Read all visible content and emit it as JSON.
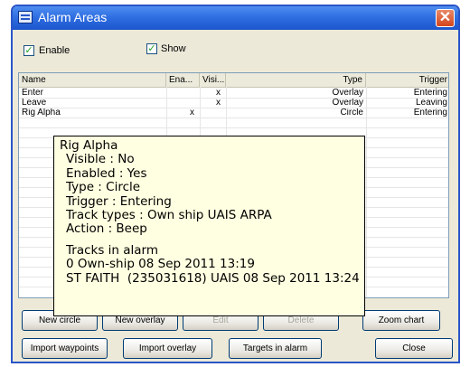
{
  "window": {
    "title": "Alarm Areas",
    "close_glyph": "✕"
  },
  "options": {
    "enable": {
      "label": "Enable",
      "checked": true
    },
    "show": {
      "label": "Show",
      "checked": true
    }
  },
  "table": {
    "columns": [
      "Name",
      "Ena...",
      "Visi...",
      "Type",
      "Trigger"
    ],
    "rows": [
      {
        "name": "Enter",
        "enabled": "",
        "visible": "x",
        "type": "Overlay",
        "trigger": "Entering"
      },
      {
        "name": "Leave",
        "enabled": "",
        "visible": "x",
        "type": "Overlay",
        "trigger": "Leaving"
      },
      {
        "name": "Rig Alpha",
        "enabled": "x",
        "visible": "",
        "type": "Circle",
        "trigger": "Entering"
      }
    ]
  },
  "buttons_row1": {
    "new_circle": "New circle",
    "new_overlay": "New overlay",
    "edit": "Edit",
    "delete": "Delete",
    "zoom_chart": "Zoom chart"
  },
  "buttons_row2": {
    "import_waypoints": "Import waypoints",
    "import_overlay": "Import overlay",
    "targets_in_alarm": "Targets in alarm",
    "close": "Close"
  },
  "tooltip": {
    "title": "Rig Alpha",
    "visible": "Visible : No",
    "enabled": "Enabled : Yes",
    "type": "Type : Circle",
    "trigger": "Trigger : Entering",
    "track_types": "Track types : Own ship UAIS ARPA",
    "action": "Action : Beep",
    "tracks_header": "Tracks in alarm",
    "track_1": "0 Own-ship 08 Sep 2011 13:19",
    "track_2": "ST FAITH  (235031618) UAIS 08 Sep 2011 13:24"
  },
  "colors": {
    "titlebar": "#2f6fe2",
    "tooltip_bg": "#ffffe1",
    "dialog_bg": "#ece9d8"
  }
}
